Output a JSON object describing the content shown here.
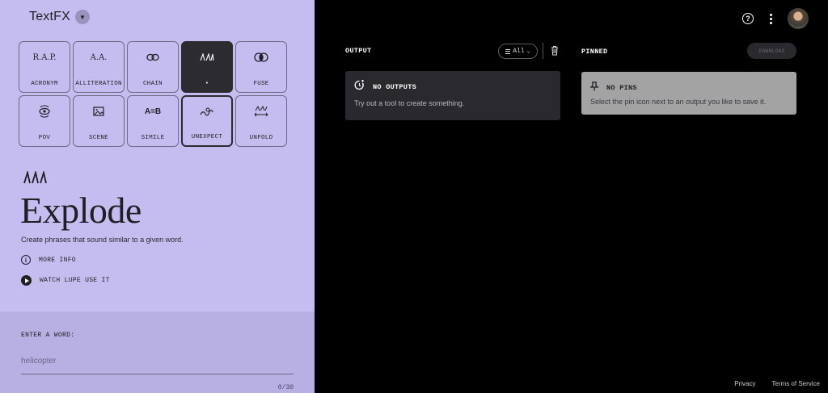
{
  "app": {
    "title": "TextFX"
  },
  "tools": [
    {
      "id": "acronym",
      "icon_text": "R.A.P.",
      "label": "ACRONYM"
    },
    {
      "id": "alliteration",
      "icon_text": "A.A.",
      "label": "ALLITERATION"
    },
    {
      "id": "chain",
      "icon": "link-icon",
      "label": "CHAIN"
    },
    {
      "id": "explode",
      "icon": "explode-icon",
      "label": "•",
      "state": "active"
    },
    {
      "id": "fuse",
      "icon": "fuse-icon",
      "label": "FUSE"
    },
    {
      "id": "pov",
      "icon": "pov-icon",
      "label": "POV"
    },
    {
      "id": "scene",
      "icon": "image-icon",
      "label": "SCENE"
    },
    {
      "id": "simile",
      "icon_text": "A=B",
      "label": "SIMILE"
    },
    {
      "id": "unexpect",
      "icon": "unexpect-icon",
      "label": "UNEXPECT",
      "state": "selected"
    },
    {
      "id": "unfold",
      "icon": "unfold-icon",
      "label": "UNFOLD"
    }
  ],
  "hero": {
    "title": "Explode",
    "description": "Create phrases that sound similar to a given word.",
    "more_info": "MORE INFO",
    "watch": "WATCH LUPE USE IT"
  },
  "input": {
    "label": "ENTER A WORD:",
    "placeholder": "helicopter",
    "value": "",
    "counter": "0/30"
  },
  "output": {
    "label": "OUTPUT",
    "filter": "All",
    "empty_title": "NO OUTPUTS",
    "empty_text": "Try out a tool to create something."
  },
  "pinned": {
    "label": "PINNED",
    "download": "DOWNLOAD",
    "empty_title": "NO PINS",
    "empty_text": "Select the pin icon next to an output you like to save it."
  },
  "footer": {
    "privacy": "Privacy",
    "terms": "Terms of Service"
  },
  "colors": {
    "panel": "#c5bdf0",
    "input_panel": "#b8b0e3",
    "active_tile": "#2b2b30",
    "output_card": "#2a2a2e",
    "pinned_card": "#a3a3a3"
  }
}
